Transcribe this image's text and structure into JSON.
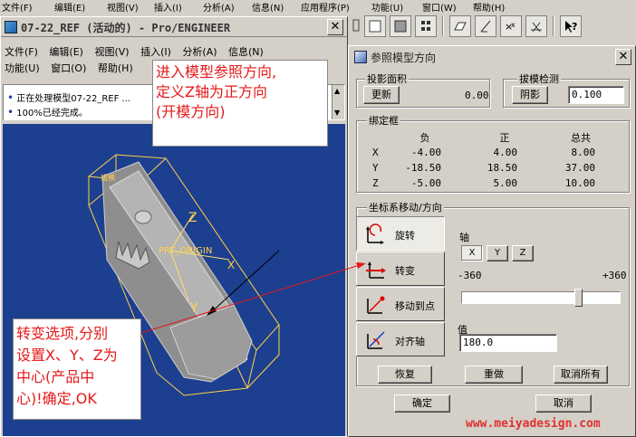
{
  "underlying_menu": [
    "文件(F)",
    "编辑(E)",
    "视图(V)",
    "插入(I)",
    "分析(A)",
    "信息(N)",
    "应用程序(P)",
    "功能(U)",
    "窗口(W)",
    "帮助(H)"
  ],
  "main_window": {
    "title": "07-22_REF (活动的) - Pro/ENGINEER",
    "menu_row1": [
      "文件(F)",
      "编辑(E)",
      "视图(V)",
      "插入(I)",
      "分析(A)",
      "信息(N)"
    ],
    "menu_row2": [
      "功能(U)",
      "窗口(O)",
      "帮助(H)"
    ],
    "messages": [
      "正在处理模型07-22_REF ...",
      "100%已经完成。"
    ],
    "viewport": {
      "labels": [
        "PRT_ORIGIN",
        "Z",
        "X",
        "Y",
        "拔模"
      ],
      "colors": {
        "background": "#1d3f8f",
        "model": "#9a9a9a",
        "bbox": "#ffd34a"
      }
    }
  },
  "annotations": {
    "top": [
      "进入模型参照方向,",
      "定义Z轴为正方向",
      "(开模方向)"
    ],
    "bottom": [
      "转变选项,分别",
      "设置X、Y、Z为",
      "中心(产品中",
      "心)!确定,OK"
    ]
  },
  "dialog": {
    "title": "参照模型方向",
    "projection": {
      "label": "投影面积",
      "button": "更新",
      "value": "0.00"
    },
    "draft": {
      "label": "拔模检测",
      "button": "阴影",
      "value": "0.100"
    },
    "bbox": {
      "label": "绑定框",
      "headers": [
        "负",
        "正",
        "总共"
      ],
      "rows": [
        {
          "axis": "X",
          "neg": "-4.00",
          "pos": "4.00",
          "total": "8.00"
        },
        {
          "axis": "Y",
          "neg": "-18.50",
          "pos": "18.50",
          "total": "37.00"
        },
        {
          "axis": "Z",
          "neg": "-5.00",
          "pos": "5.00",
          "total": "10.00"
        }
      ]
    },
    "move": {
      "label": "坐标系移动/方向",
      "modes": [
        "旋转",
        "转变",
        "移动到点",
        "对齐轴"
      ],
      "axis_label": "轴",
      "axes": [
        "X",
        "Y",
        "Z"
      ],
      "range_min": "-360",
      "range_max": "+360",
      "slider_value": 180.0,
      "value_label": "值",
      "value": "180.0"
    },
    "buttons": [
      "恢复",
      "重做",
      "取消所有"
    ],
    "ok": "确定",
    "cancel": "取消"
  },
  "watermark": "www.meiyadesign.com"
}
